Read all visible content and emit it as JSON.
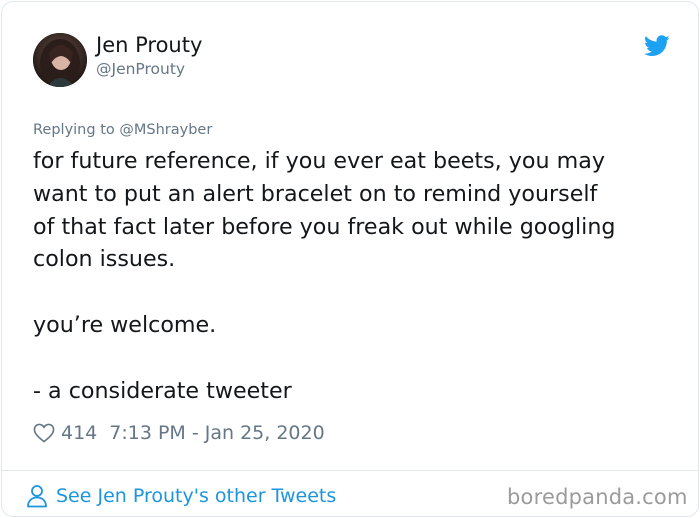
{
  "author": {
    "name": "Jen Prouty",
    "handle": "@JenProuty"
  },
  "icons": {
    "brand": "twitter-bird-icon",
    "like": "heart-icon",
    "profile": "person-icon"
  },
  "colors": {
    "brand": "#1da1f2",
    "link": "#1b95e0",
    "muted": "#657786"
  },
  "tweet": {
    "replying_prefix": "Replying to ",
    "replying_to": "@MShrayber",
    "text": "for future reference, if you ever eat beets, you may\nwant to put an alert bracelet on to remind yourself\nof that fact later before you freak out while googling\ncolon issues.\n\nyou’re welcome.\n\n- a considerate tweeter",
    "likes": "414",
    "timestamp": "7:13 PM - Jan 25, 2020"
  },
  "footer": {
    "link_label": "See Jen Prouty's other Tweets"
  },
  "watermark": "boredpanda.com"
}
